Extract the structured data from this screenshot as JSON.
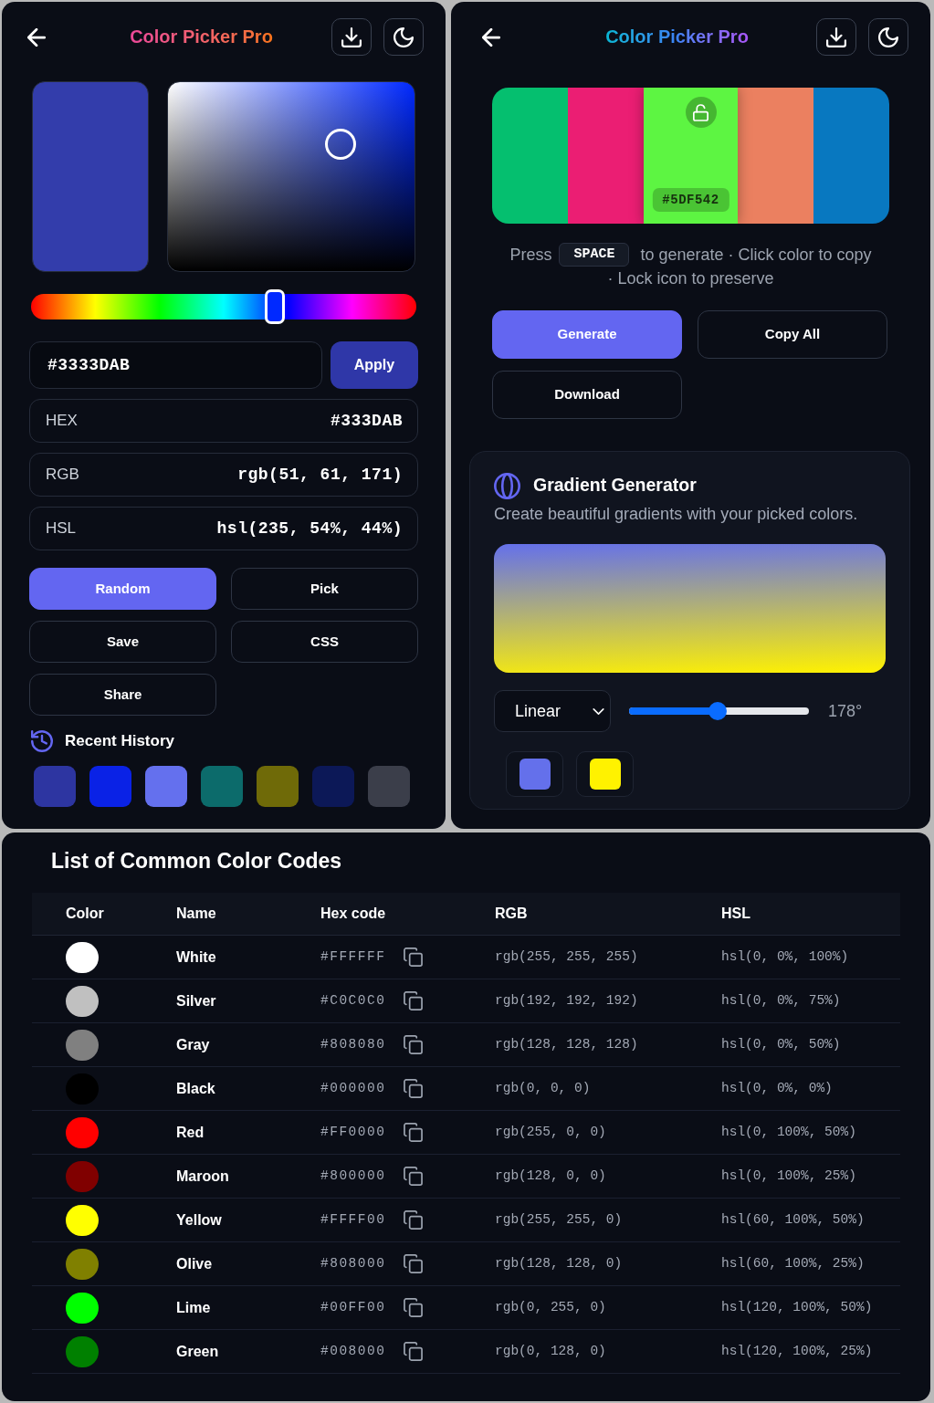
{
  "picker_panel": {
    "title": "Color Picker Pro",
    "preview": {
      "color": "#333dab"
    },
    "hue": {
      "level": 0.64
    },
    "hex_input": {
      "value": "#3333DAB"
    },
    "apply_button": "Apply",
    "formats": [
      {
        "label": "HEX",
        "value": "#333DAB"
      },
      {
        "label": "RGB",
        "value": "rgb(51, 61, 171)"
      },
      {
        "label": "HSL",
        "value": "hsl(235, 54%, 44%)"
      }
    ],
    "actions": [
      {
        "label": "Random",
        "kind": "primary"
      },
      {
        "label": "Pick",
        "kind": "outline"
      },
      {
        "label": "Save",
        "kind": "outline"
      },
      {
        "label": "CSS",
        "kind": "outline"
      },
      {
        "label": "Share",
        "kind": "outline"
      }
    ],
    "history": {
      "title": "Recent History",
      "swatches": [
        {
          "color": "#2d35a1"
        },
        {
          "color": "#0a22e6"
        },
        {
          "color": "#6470ee"
        },
        {
          "color": "#0c6b6b"
        },
        {
          "color": "#6f6a08"
        },
        {
          "color": "#0c1857"
        },
        {
          "color": "#3b3e4a"
        }
      ]
    }
  },
  "palette_panel": {
    "title": "Color Picker Pro",
    "palette": [
      {
        "color": "#05bf6f",
        "hovered": false
      },
      {
        "color": "#eb1e73",
        "hovered": false
      },
      {
        "color": "#5df542",
        "hovered": true,
        "hex": "#5DF542",
        "locked": false
      },
      {
        "color": "#eb8060",
        "hovered": false
      },
      {
        "color": "#0878c0",
        "hovered": false
      }
    ],
    "hint": {
      "before": "Press",
      "key": "SPACE",
      "after": [
        "to generate · Click color to copy",
        "· Lock icon to preserve"
      ]
    },
    "actions": [
      {
        "label": "Generate",
        "kind": "primary"
      },
      {
        "label": "Copy All",
        "kind": "outline"
      },
      {
        "label": "Download",
        "kind": "outline"
      }
    ],
    "gradient": {
      "title": "Gradient Generator",
      "description": "Create beautiful gradients with your picked colors.",
      "type": {
        "value": "Linear"
      },
      "angle": {
        "level": 0.494,
        "reading": "178°"
      },
      "stops": [
        {
          "color": "#6470eb"
        },
        {
          "color": "#fff200"
        }
      ]
    }
  },
  "color_table": {
    "title": "List of Common Color Codes",
    "columns": [
      "Color",
      "Name",
      "Hex code",
      "RGB",
      "HSL"
    ],
    "rows": [
      {
        "color": "#ffffff",
        "name": "White",
        "hex": "#FFFFFF",
        "rgb": "rgb(255, 255, 255)",
        "hsl": "hsl(0, 0%, 100%)"
      },
      {
        "color": "#c0c0c0",
        "name": "Silver",
        "hex": "#C0C0C0",
        "rgb": "rgb(192, 192, 192)",
        "hsl": "hsl(0, 0%, 75%)"
      },
      {
        "color": "#808080",
        "name": "Gray",
        "hex": "#808080",
        "rgb": "rgb(128, 128, 128)",
        "hsl": "hsl(0, 0%, 50%)"
      },
      {
        "color": "#000000",
        "name": "Black",
        "hex": "#000000",
        "rgb": "rgb(0, 0, 0)",
        "hsl": "hsl(0, 0%, 0%)"
      },
      {
        "color": "#ff0000",
        "name": "Red",
        "hex": "#FF0000",
        "rgb": "rgb(255, 0, 0)",
        "hsl": "hsl(0, 100%, 50%)"
      },
      {
        "color": "#800000",
        "name": "Maroon",
        "hex": "#800000",
        "rgb": "rgb(128, 0, 0)",
        "hsl": "hsl(0, 100%, 25%)"
      },
      {
        "color": "#ffff00",
        "name": "Yellow",
        "hex": "#FFFF00",
        "rgb": "rgb(255, 255, 0)",
        "hsl": "hsl(60, 100%, 50%)"
      },
      {
        "color": "#808000",
        "name": "Olive",
        "hex": "#808000",
        "rgb": "rgb(128, 128, 0)",
        "hsl": "hsl(60, 100%, 25%)"
      },
      {
        "color": "#00ff00",
        "name": "Lime",
        "hex": "#00FF00",
        "rgb": "rgb(0, 255, 0)",
        "hsl": "hsl(120, 100%, 50%)"
      },
      {
        "color": "#008000",
        "name": "Green",
        "hex": "#008000",
        "rgb": "rgb(0, 128, 0)",
        "hsl": "hsl(120, 100%, 25%)"
      }
    ]
  }
}
